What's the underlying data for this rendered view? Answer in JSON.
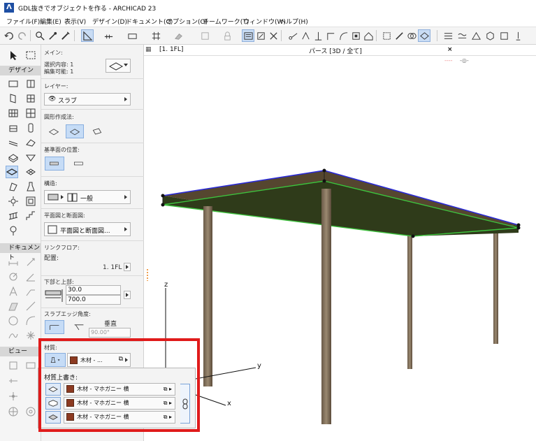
{
  "window": {
    "title": "GDL抜きでオブジェクトを作る - ARCHICAD 23"
  },
  "menu": [
    "ファイル(F)",
    "編集(E)",
    "表示(V)",
    "デザイン(D)",
    "ドキュメント(C)",
    "オプション(O)",
    "チームワーク(T)",
    "ウィンドウ(W)",
    "ヘルプ(H)"
  ],
  "tabs": {
    "floor": "[1. 1FL]",
    "perspective": "パース [3D / 全て]",
    "close": "×"
  },
  "toolbox": {
    "design_header": "デザイン",
    "document_header": "ドキュメント",
    "view_header": "ビュー"
  },
  "infobox": {
    "main_label": "メイン:",
    "selected": "選択内容: 1",
    "editable": "編集可能: 1",
    "layer_label": "レイヤー:",
    "layer_value": "スラブ",
    "geometry_label": "図形作成法:",
    "refplane_label": "基準面の位置:",
    "structure_label": "構造:",
    "structure_value": "一般",
    "plan_label": "平面図と断面図:",
    "plan_button": "平面図と断面図...",
    "link_label": "リンクフロア:",
    "placement_label": "配置:",
    "placement_value": "1. 1FL",
    "bottom_top_label": "下部と上部:",
    "thickness": "30.0",
    "elevation": "700.0",
    "edge_angle_label": "スラブエッジ角度:",
    "vertical_label": "垂直",
    "angle_value": "90.00°",
    "material_label": "材質:",
    "material_value": "木材 - ..."
  },
  "override": {
    "title": "材質上書き:",
    "rows": [
      {
        "value": "木材 - マホガニー 横"
      },
      {
        "value": "木材 - マホガニー 横"
      },
      {
        "value": "木材 - マホガニー 横"
      }
    ]
  },
  "axes": {
    "z": "z",
    "y": "y",
    "x": "x"
  },
  "colors": {
    "highlight": "#e01b1b",
    "material_chip": "#8c3a21",
    "selection_blue": "#c6dcf6",
    "slab_outline_green": "#3ec23e",
    "slab_outline_blue": "#2b2bd6"
  }
}
